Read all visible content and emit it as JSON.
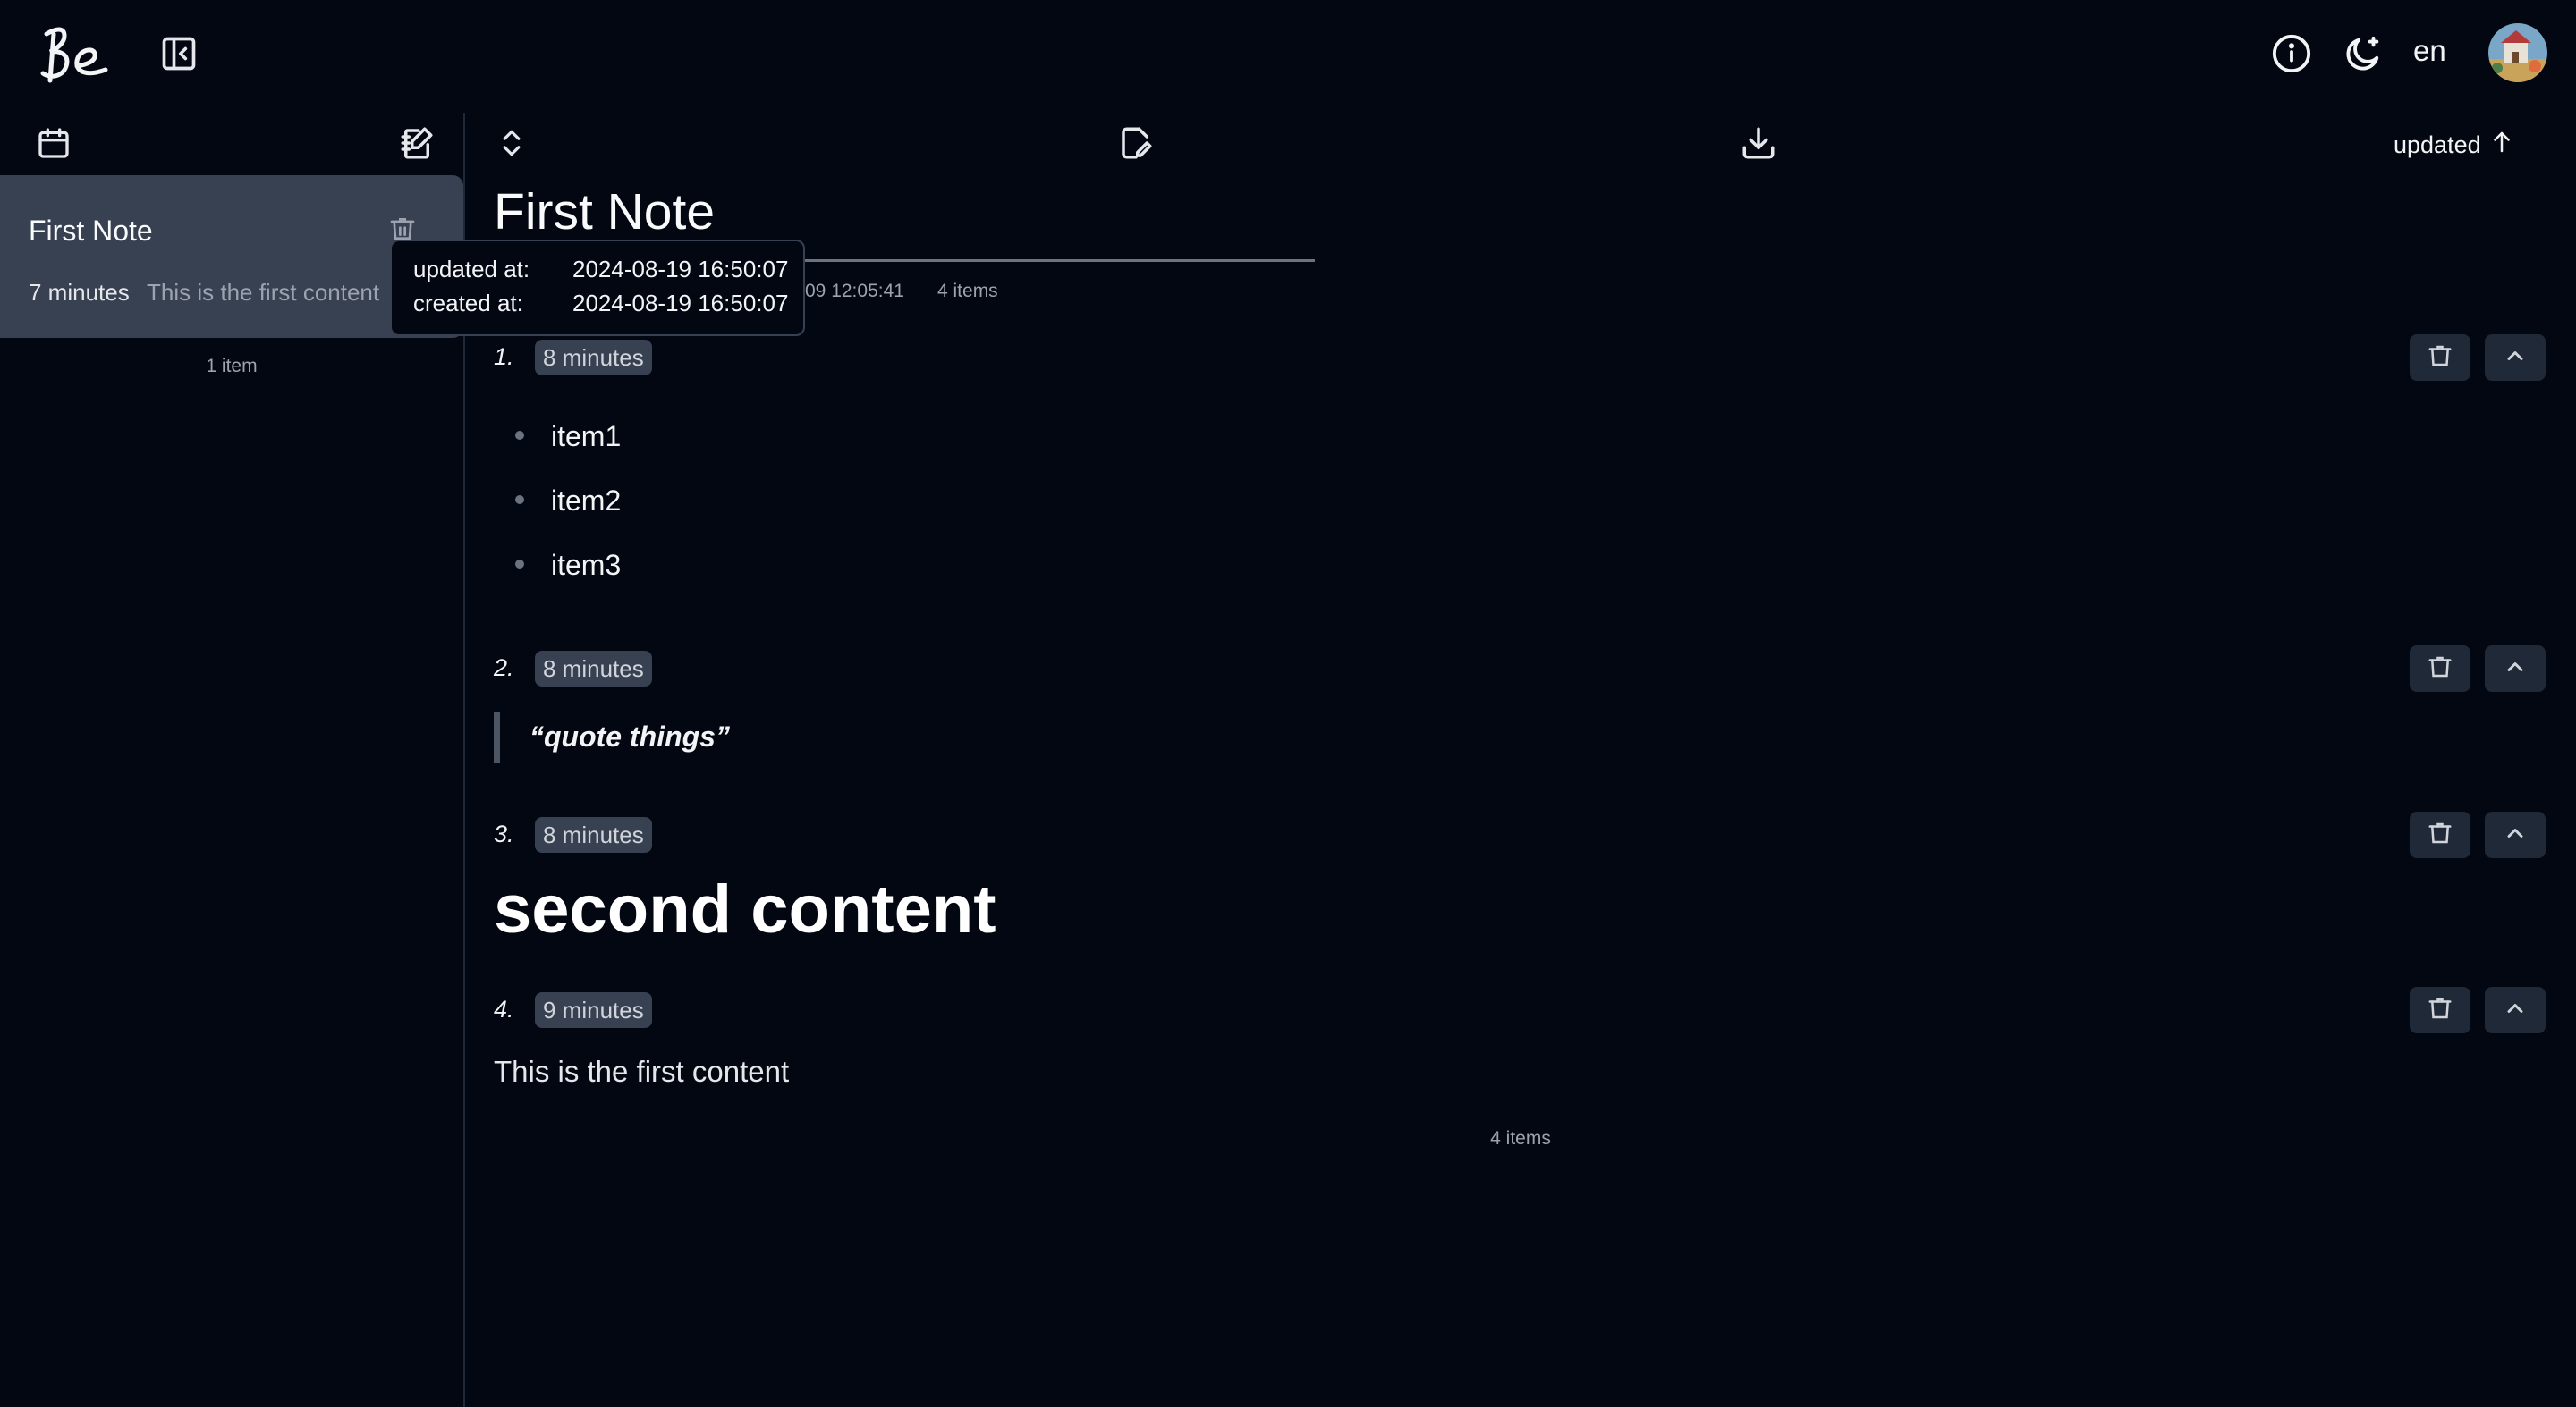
{
  "header": {
    "logo_text": "Be",
    "icons": [
      "sidebar-toggle-icon",
      "info-icon",
      "moon-icon"
    ],
    "language": "en"
  },
  "sidebar": {
    "icons": [
      "calendar-icon",
      "new-note-icon"
    ],
    "notes": [
      {
        "title": "First Note",
        "time": "7 minutes",
        "preview": "This is the first content"
      }
    ],
    "count": "1 item"
  },
  "toolbar": {
    "icons": [
      "expand-collapse-icon",
      "edit-icon",
      "download-icon"
    ],
    "sort_label": "updated",
    "sort_direction_icon": "arrow-up-icon"
  },
  "note": {
    "title": "First Note",
    "meta_date": "09 12:05:41",
    "meta_count": "4 items"
  },
  "tooltip": {
    "updated_label": "updated at:",
    "updated_value": "2024-08-19 16:50:07",
    "created_label": "created at:",
    "created_value": "2024-08-19 16:50:07"
  },
  "items": [
    {
      "num": "1.",
      "time": "8 minutes",
      "list": [
        "item1",
        "item2",
        "item3"
      ]
    },
    {
      "num": "2.",
      "time": "8 minutes",
      "quote": "“quote things”"
    },
    {
      "num": "3.",
      "time": "8 minutes",
      "heading": "second content"
    },
    {
      "num": "4.",
      "time": "9 minutes",
      "text": "This is the first content"
    }
  ],
  "items_count": "4 items",
  "colors": {
    "background": "#030712",
    "card": "#374151",
    "badge": "#374151",
    "button": "#1f2937"
  }
}
